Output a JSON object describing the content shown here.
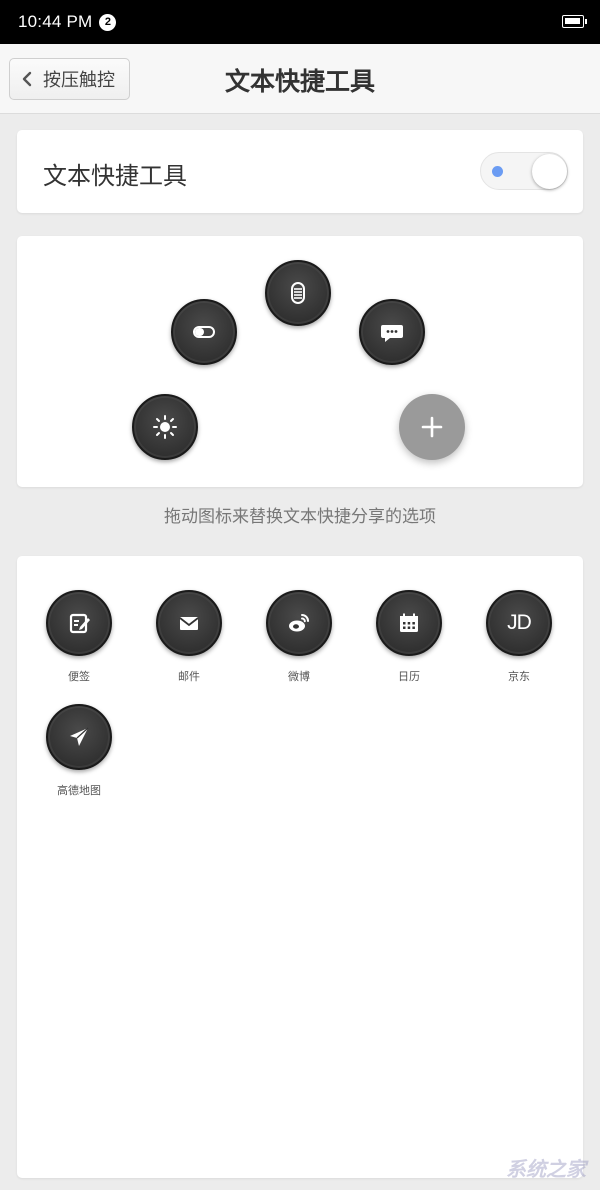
{
  "status_bar": {
    "time": "10:44 PM",
    "notification_count": "2"
  },
  "header": {
    "back_label": "按压触控",
    "title": "文本快捷工具"
  },
  "toggle_card": {
    "label": "文本快捷工具",
    "switch_on": true,
    "accent": "#6b9cf3"
  },
  "arc_actions": [
    {
      "icon": "brightness-icon"
    },
    {
      "icon": "toggle-pill-icon"
    },
    {
      "icon": "capsule-icon"
    },
    {
      "icon": "chat-bubble-icon"
    },
    {
      "icon": "plus-icon"
    }
  ],
  "hint_text": "拖动图标来替换文本快捷分享的选项",
  "apps": [
    {
      "label": "便签",
      "icon": "notes-icon"
    },
    {
      "label": "邮件",
      "icon": "mail-icon"
    },
    {
      "label": "微博",
      "icon": "weibo-icon"
    },
    {
      "label": "日历",
      "icon": "calendar-icon"
    },
    {
      "label": "京东",
      "icon": "jd-icon",
      "glyph": "JD"
    },
    {
      "label": "高德地图",
      "icon": "amap-icon"
    }
  ],
  "watermark": "系统之家"
}
